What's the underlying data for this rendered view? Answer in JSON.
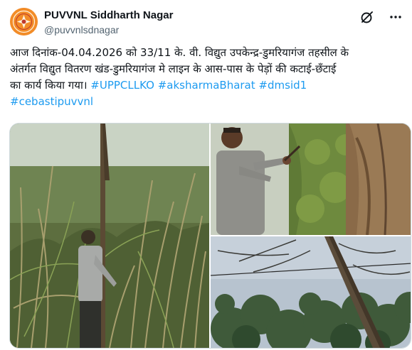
{
  "account": {
    "display_name": "PUVVNL Siddharth Nagar",
    "handle": "@puvvnlsdnagar",
    "avatar_icon": "organization-logo-icon"
  },
  "actions": {
    "grok_icon": "grok-icon",
    "more_icon": "more-options-icon"
  },
  "tweet": {
    "line1": "आज दिनांक-04.04.2026 को 33/11 के. वी. विद्युत उपकेन्द्र-डुमरियागंज तहसील के",
    "line2": "अंतर्गत विद्युत वितरण खंड-डुमरियागंज मे लाइन के  आस-पास के पेड़ों की कटाई-छँटाई",
    "line3": "का कार्य किया गया।  ",
    "hashtags": [
      "#UPPCLLKO",
      "#aksharmaBharat",
      "#dmsid1",
      "#cebastipuvvnl"
    ]
  },
  "colors": {
    "link": "#1d9bf0",
    "secondary_text": "#536471",
    "border": "#cfd9de",
    "avatar_bg": "#f28c28"
  },
  "media": [
    {
      "name": "photo-worker-in-tall-grass"
    },
    {
      "name": "photo-worker-cutting-branch"
    },
    {
      "name": "photo-tree-near-power-line"
    }
  ]
}
